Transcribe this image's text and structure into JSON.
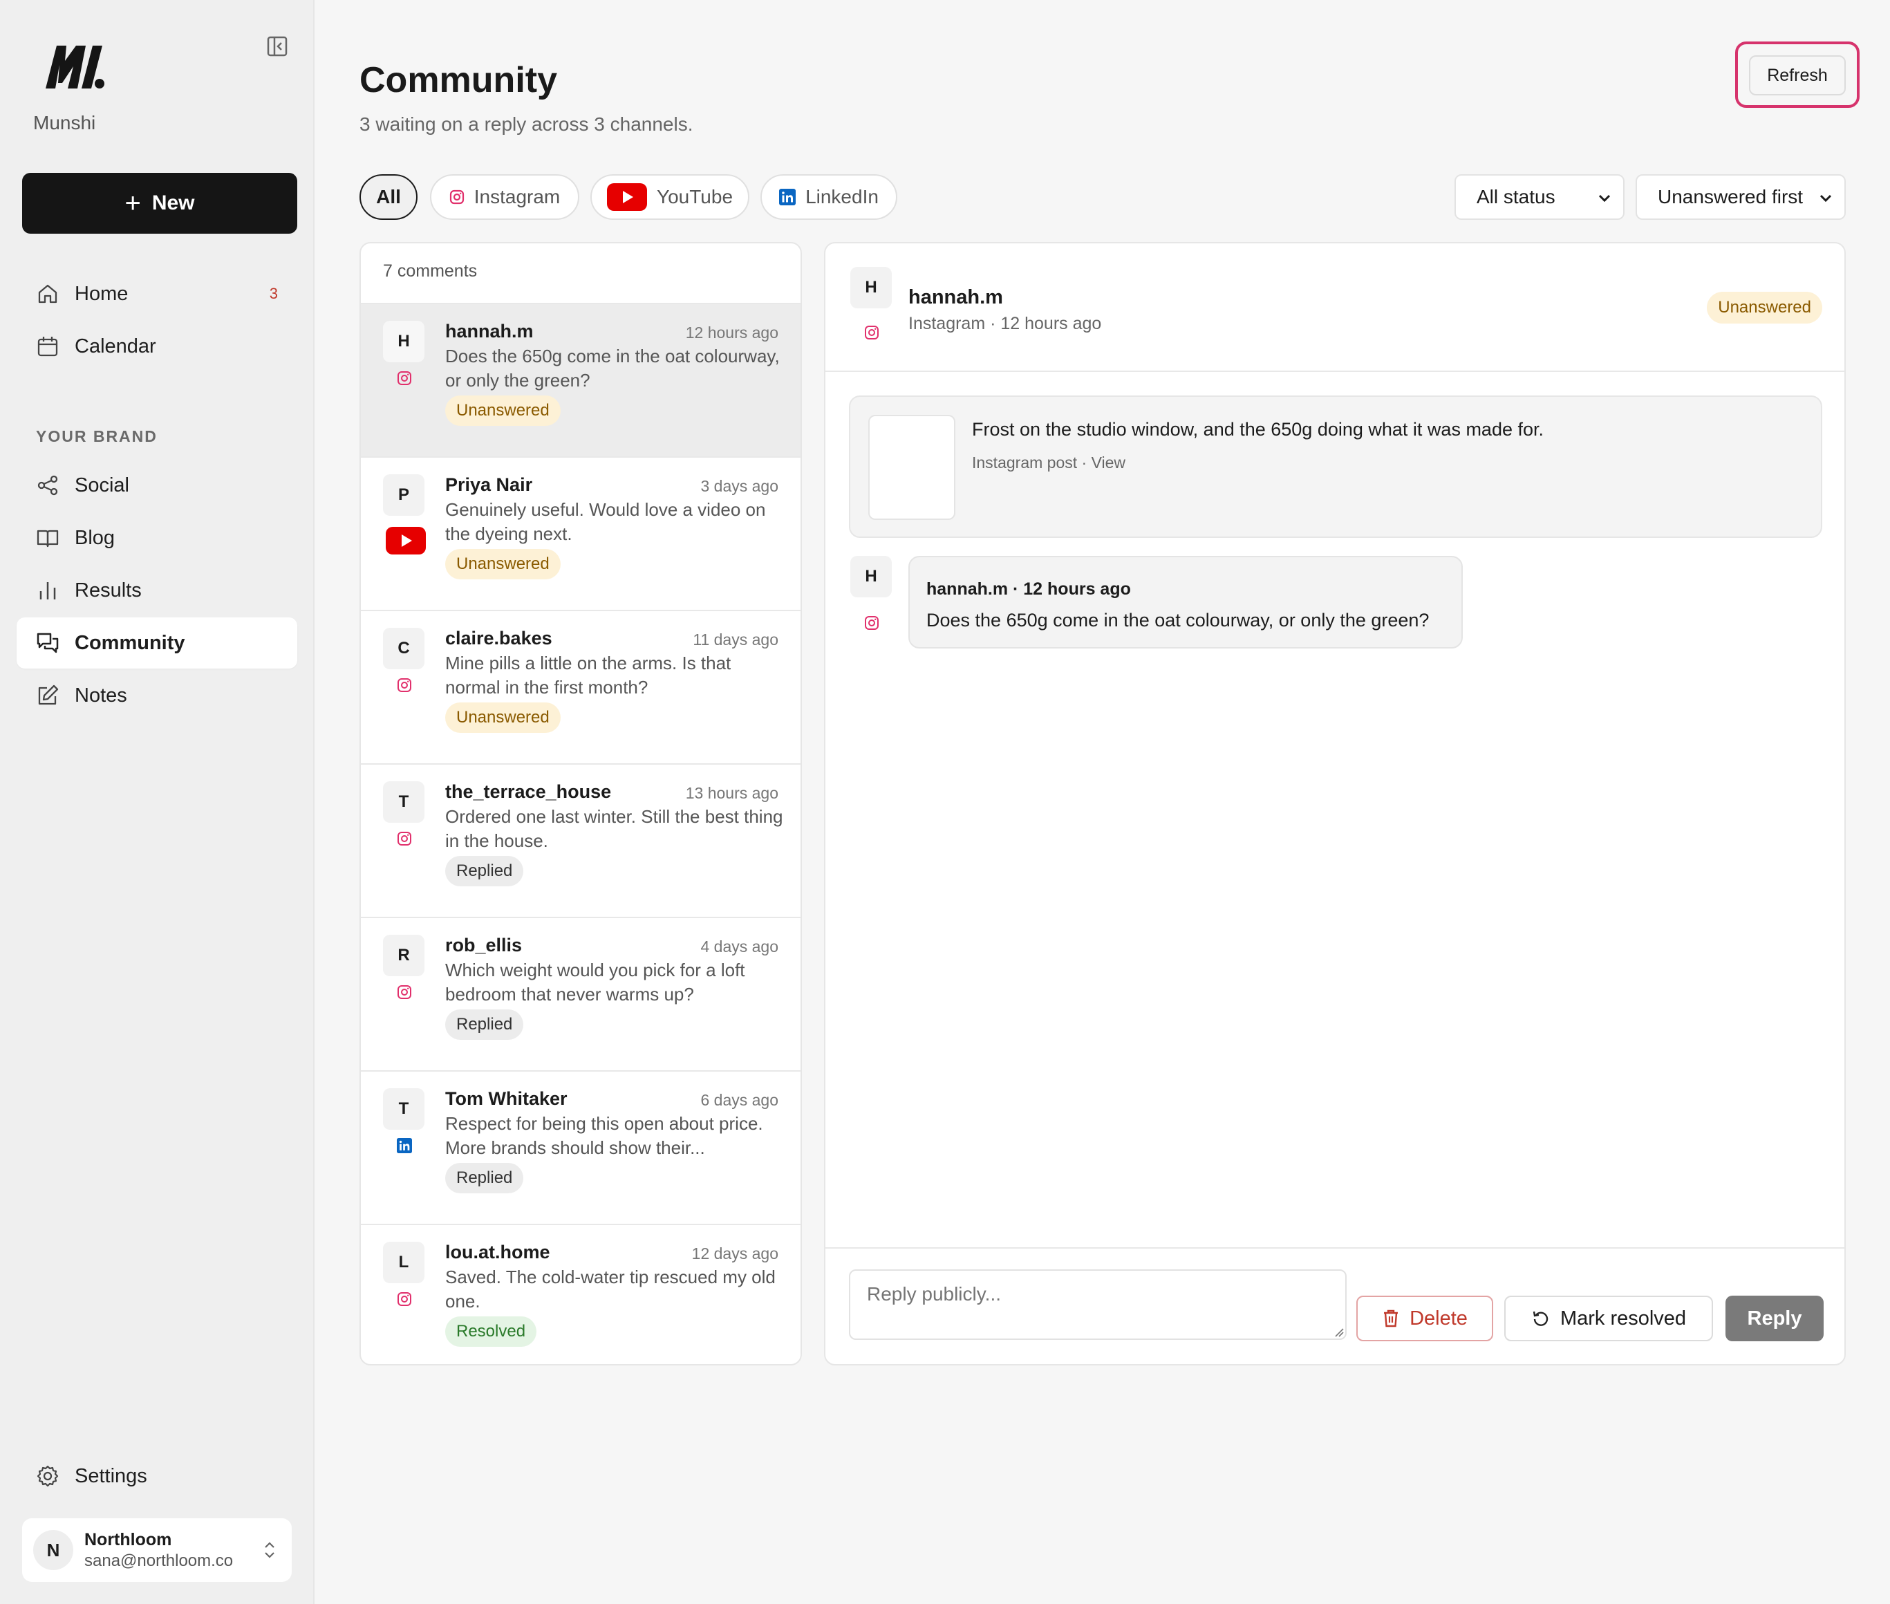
{
  "brand": {
    "name": "Munshi"
  },
  "sidebar": {
    "new_label": "New",
    "nav": [
      {
        "label": "Home",
        "badge": "3",
        "icon": "home-icon"
      },
      {
        "label": "Calendar",
        "icon": "calendar-icon"
      }
    ],
    "section_label": "YOUR BRAND",
    "brand_nav": [
      {
        "label": "Social",
        "icon": "share-icon"
      },
      {
        "label": "Blog",
        "icon": "book-icon"
      },
      {
        "label": "Results",
        "icon": "bar-chart-icon"
      },
      {
        "label": "Community",
        "icon": "chat-icon",
        "active": true
      },
      {
        "label": "Notes",
        "icon": "edit-icon"
      }
    ],
    "settings_label": "Settings",
    "account": {
      "initial": "N",
      "name": "Northloom",
      "email": "sana@northloom.co"
    }
  },
  "header": {
    "title": "Community",
    "subtitle": "3 waiting on a reply across 3 channels.",
    "refresh_label": "Refresh"
  },
  "filters": {
    "channels": [
      "All",
      "Instagram",
      "YouTube",
      "LinkedIn"
    ],
    "active_channel": "All",
    "status_select": "All status",
    "sort_select": "Unanswered first"
  },
  "list": {
    "count_label": "7 comments",
    "items": [
      {
        "initial": "H",
        "user": "hannah.m",
        "time": "12 hours ago",
        "channel": "instagram",
        "text": "Does the 650g come in the oat colourway, or only the green?",
        "status": "Unanswered"
      },
      {
        "initial": "P",
        "user": "Priya Nair",
        "time": "3 days ago",
        "channel": "youtube",
        "text": "Genuinely useful. Would love a video on the dyeing next.",
        "status": "Unanswered"
      },
      {
        "initial": "C",
        "user": "claire.bakes",
        "time": "11 days ago",
        "channel": "instagram",
        "text": "Mine pills a little on the arms. Is that normal in the first month?",
        "status": "Unanswered"
      },
      {
        "initial": "T",
        "user": "the_terrace_house",
        "time": "13 hours ago",
        "channel": "instagram",
        "text": "Ordered one last winter. Still the best thing in the house.",
        "status": "Replied"
      },
      {
        "initial": "R",
        "user": "rob_ellis",
        "time": "4 days ago",
        "channel": "instagram",
        "text": "Which weight would you pick for a loft bedroom that never warms up?",
        "status": "Replied"
      },
      {
        "initial": "T",
        "user": "Tom Whitaker",
        "time": "6 days ago",
        "channel": "linkedin",
        "text": "Respect for being this open about price. More brands should show their...",
        "status": "Replied"
      },
      {
        "initial": "L",
        "user": "lou.at.home",
        "time": "12 days ago",
        "channel": "instagram",
        "text": "Saved. The cold-water tip rescued my old one.",
        "status": "Resolved"
      }
    ]
  },
  "detail": {
    "initial": "H",
    "user": "hannah.m",
    "meta": "Instagram · 12 hours ago",
    "status": "Unanswered",
    "post_text": "Frost on the studio window, and the 650g doing what it was made for.",
    "post_meta": "Instagram post · View",
    "comment_header": "hannah.m · 12 hours ago",
    "comment_text": "Does the 650g come in the oat colourway, or only the green?",
    "reply_placeholder": "Reply publicly...",
    "delete_label": "Delete",
    "resolve_label": "Mark resolved",
    "reply_label": "Reply"
  },
  "colors": {
    "accent_ring": "#d6336c",
    "instagram": "#e1306c",
    "youtube": "#e60000",
    "linkedin": "#0a66c2",
    "unanswered_bg": "#fdf1d6",
    "resolved_text": "#2a7a2a"
  }
}
